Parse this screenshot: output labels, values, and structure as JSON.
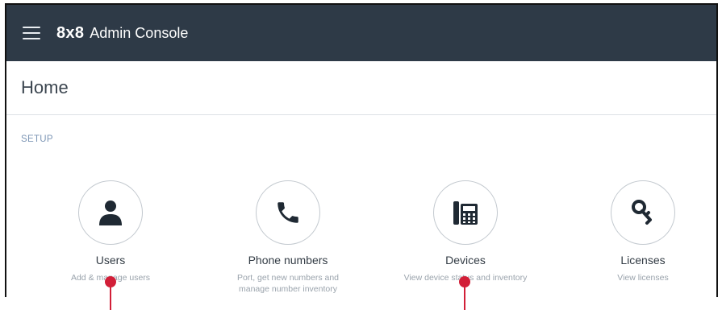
{
  "app": {
    "logo_text": "8x8",
    "title": "Admin Console"
  },
  "page": {
    "title": "Home"
  },
  "section": {
    "label": "SETUP"
  },
  "cards": [
    {
      "title": "Users",
      "subtitle": "Add & manage users",
      "icon": "user-icon"
    },
    {
      "title": "Phone numbers",
      "subtitle": "Port, get new numbers and manage number inventory",
      "icon": "phone-icon"
    },
    {
      "title": "Devices",
      "subtitle": "View device status and inventory",
      "icon": "desk-phone-icon"
    },
    {
      "title": "Licenses",
      "subtitle": "View licenses",
      "icon": "key-icon"
    }
  ],
  "colors": {
    "topbar": "#2e3a47",
    "section_label": "#7e97b6",
    "marker": "#d21f38"
  }
}
